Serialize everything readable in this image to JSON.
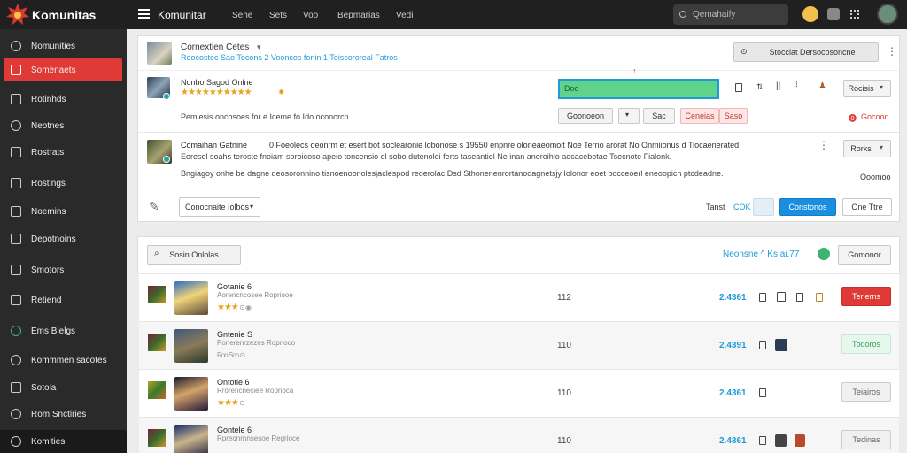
{
  "app": {
    "brand": "Komunitas",
    "title": "Komunitar",
    "nav": [
      "Sene",
      "Sets",
      "Voo",
      "Bepmarias",
      "Vedi"
    ]
  },
  "search": {
    "placeholder": "Qemahaify"
  },
  "sidebar": {
    "items": [
      {
        "label": "Nomunities",
        "icon": "gear-icon"
      },
      {
        "label": "Somenaets",
        "icon": "box-icon"
      },
      {
        "label": "Rotinhds",
        "icon": "grid-icon"
      },
      {
        "label": "Neotnes",
        "icon": "circle-icon"
      },
      {
        "label": "Rostrats",
        "icon": "list-icon"
      },
      {
        "label": "Rostings",
        "icon": "arrow-icon"
      },
      {
        "label": "Noemins",
        "icon": "pen-icon"
      },
      {
        "label": "Depotnoins",
        "icon": "doc-icon"
      },
      {
        "label": "Smotors",
        "icon": "dropdown-icon"
      },
      {
        "label": "Retiend",
        "icon": "tag-icon"
      },
      {
        "label": "Ems Blelgs",
        "icon": "globe-icon"
      },
      {
        "label": "Kommmen sacotes",
        "icon": "circle-icon"
      },
      {
        "label": "Sotola",
        "icon": "folder-icon"
      },
      {
        "label": "Rom Snctiries",
        "icon": "circle-icon"
      },
      {
        "label": "Komities",
        "icon": "gear-icon"
      }
    ],
    "active": 1
  },
  "header": {
    "title": "Cornextien Cetes",
    "meta": "Reocostec  Sao  Tocons  2  Vooncos  fonin  1  Teiscororeal  Fatros",
    "action": "Stocclat  Dersocosoncne"
  },
  "post1": {
    "title": "Nonbo Sagod Onlne",
    "stars": "★★★★★★★★★★",
    "desc": "Pemlesis oncosoes for  e  Iceme  fo  Ido  oconorcn",
    "input": "Doo",
    "btn_a": "Goonoeon",
    "btn_b": "",
    "btn_c": "Sac",
    "btn_d": "Ceneias",
    "btn_e": "Saso",
    "alert": "Gocoon",
    "menu": "Rocisis"
  },
  "post2": {
    "title": "Comaihan Gatnine",
    "line1": "0  Foeolecs  oeonrm  et esert  bot soclearonie  lobonose  s 19550  enpnre  oloneaeomoit  Noe  Terno arorat  No  Onmiionus  d  Tiocaenerated.",
    "line2": "Eoresol  soahs  teroste  fnoiam  soroicoso apeio  toncensio  ol  sobo  dutenoloi  ferts  taseantiel  Ne  inan  aneroihlo  aocacebotae  Tsecnote  Fialonk.",
    "line3": "Bngiagoy  onhe  be dagne  deosoronnino  tisnoenoonolesjaclespod  reoerolac  Dsd  Sthonenenrortanooagnetsjy  Iolonor  eoet  bocceoerl  eneoopicn  ptcdeadne.",
    "menu": "Rorks",
    "side": "Ooomoo",
    "filter": "Conocnaite Iolbos",
    "total_label": "Tanst",
    "total_val": "COK",
    "primary": "Constonos",
    "secondary": "One Ttre"
  },
  "list": {
    "search": "Sosin  Onlolas",
    "link": "Neonsne  ^  Ks  ai.77",
    "btn": "Gomonor"
  },
  "rows": [
    {
      "title": "Gotanie 6",
      "sub": "Aorencncosee  Ropriooe",
      "num": "112",
      "val": "2.4361",
      "btn": "Terlerns",
      "style": "red"
    },
    {
      "title": "Gntenie S",
      "sub": "Ponerenrzezes  Roprioco",
      "num": "110",
      "val": "2.4391",
      "btn": "Todoros",
      "style": "green"
    },
    {
      "title": "Ontotie 6",
      "sub": "Rrorencneciee  Roprioca",
      "num": "110",
      "val": "2.4361",
      "btn": "Teiairos",
      "style": "grey"
    },
    {
      "title": "Gontele 6",
      "sub": "Rpreonrnnsesoe  Regrioce",
      "num": "110",
      "val": "2.4361",
      "btn": "Tedinas",
      "style": "grey"
    }
  ],
  "colors": {
    "accent": "#e03a36",
    "link": "#1e9bd7",
    "topbar": "#202020",
    "sidebar": "#2a2a2a",
    "positive": "#3cb371"
  }
}
